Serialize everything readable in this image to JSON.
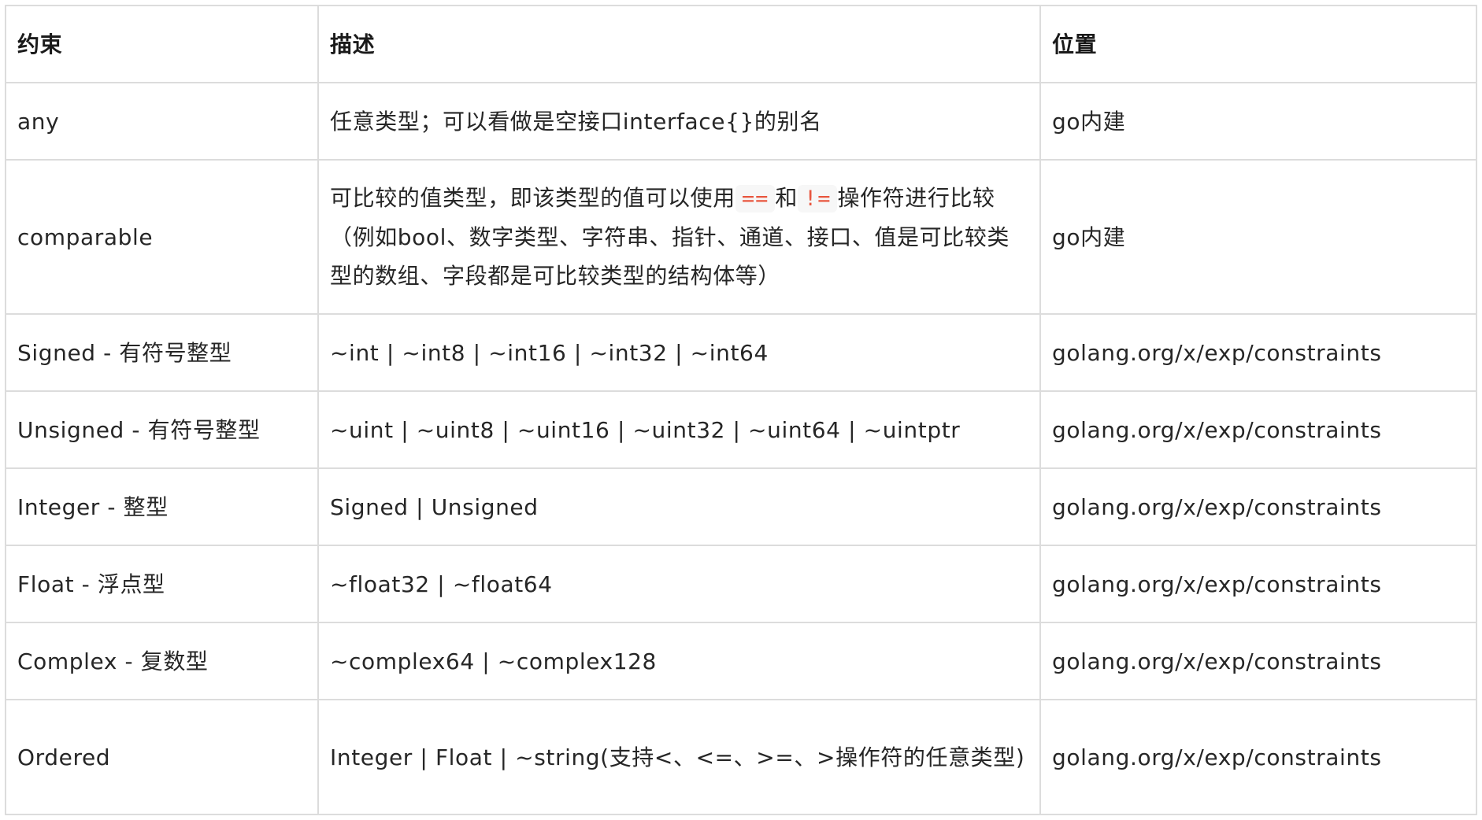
{
  "table": {
    "headers": [
      "约束",
      "描述",
      "位置"
    ],
    "rows": [
      {
        "constraint": "any",
        "description": "任意类型；可以看做是空接口interface{}的别名",
        "location": "go内建"
      },
      {
        "constraint": "comparable",
        "description_parts": {
          "before": "可比较的值类型，即该类型的值可以使用",
          "op1": "==",
          "mid": "和",
          "op2": "!=",
          "after": "操作符进行比较（例如bool、数字类型、字符串、指针、通道、接口、值是可比较类型的数组、字段都是可比较类型的结构体等）"
        },
        "location": "go内建"
      },
      {
        "constraint": "Signed - 有符号整型",
        "description": "~int | ~int8 | ~int16 | ~int32 | ~int64",
        "location": "golang.org/x/exp/constraints"
      },
      {
        "constraint": "Unsigned - 有符号整型",
        "description": "~uint | ~uint8 | ~uint16 | ~uint32 | ~uint64 | ~uintptr",
        "location": "golang.org/x/exp/constraints"
      },
      {
        "constraint": "Integer - 整型",
        "description": "Signed | Unsigned",
        "location": "golang.org/x/exp/constraints"
      },
      {
        "constraint": "Float - 浮点型",
        "description": "~float32 | ~float64",
        "location": "golang.org/x/exp/constraints"
      },
      {
        "constraint": "Complex - 复数型",
        "description": "~complex64 | ~complex128",
        "location": "golang.org/x/exp/constraints"
      },
      {
        "constraint": "Ordered",
        "description": "Integer | Float | ~string(支持<、<=、>=、>操作符的任意类型)",
        "location": "golang.org/x/exp/constraints"
      }
    ]
  },
  "colors": {
    "border": "#dcdcdc",
    "code_text": "#e8563f",
    "code_bg": "#f7f7f7"
  }
}
